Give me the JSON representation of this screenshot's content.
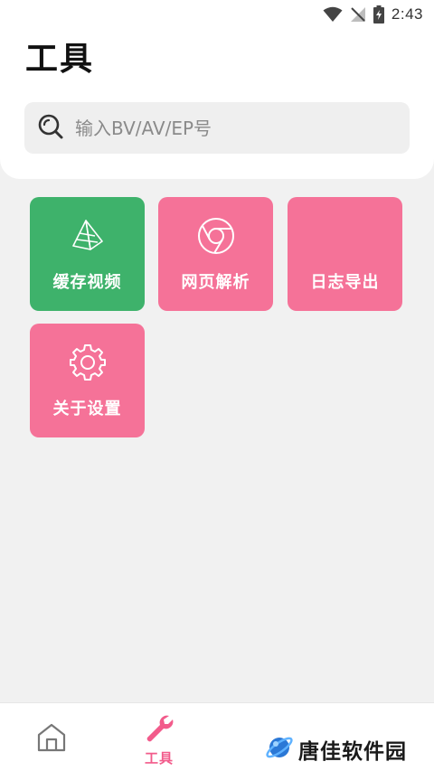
{
  "status_bar": {
    "time": "2:43"
  },
  "header": {
    "title": "工具"
  },
  "search": {
    "placeholder": "输入BV/AV/EP号",
    "value": ""
  },
  "tools": [
    {
      "label": "缓存视频",
      "icon": "zongzi-icon",
      "color": "#3eb26b"
    },
    {
      "label": "网页解析",
      "icon": "chrome-icon",
      "color": "#f57298"
    },
    {
      "label": "日志导出",
      "icon": "",
      "color": "#f57298"
    },
    {
      "label": "关于设置",
      "icon": "gear-icon",
      "color": "#f57298"
    }
  ],
  "bottom_nav": {
    "home_icon": "home-icon",
    "tools_label": "工具",
    "tools_icon": "wrench-icon",
    "active_color": "#f25b8b"
  },
  "watermark": {
    "text": "唐佳软件园"
  }
}
